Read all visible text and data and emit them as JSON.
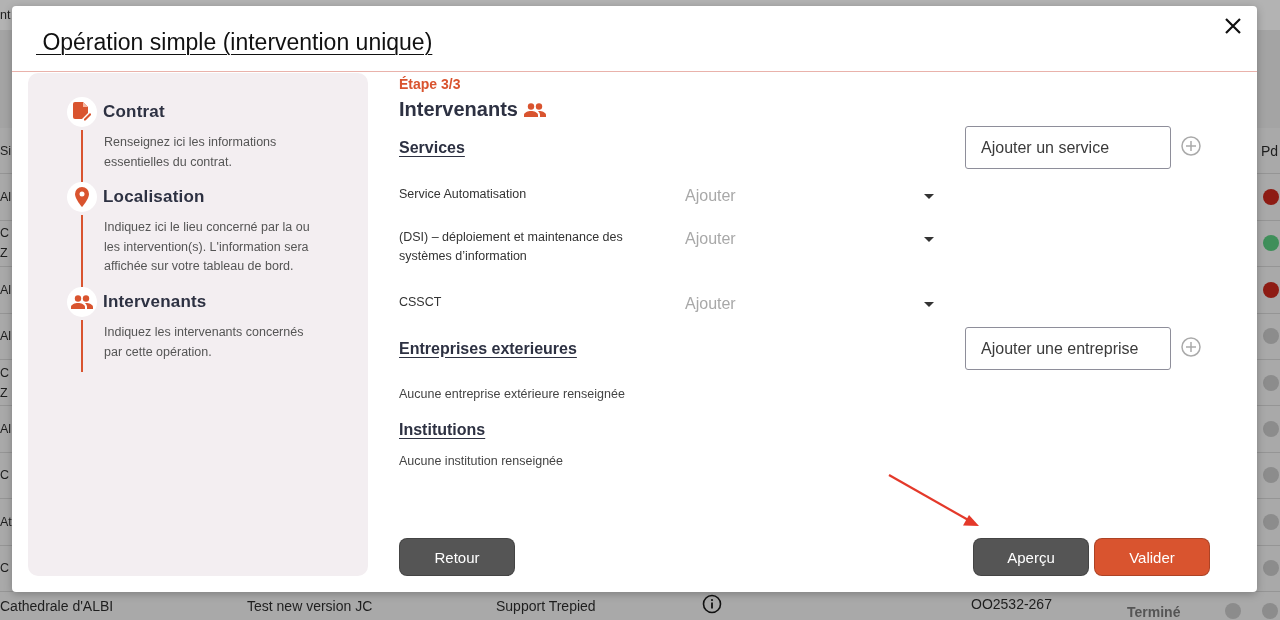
{
  "background_table": {
    "top_text": "nt",
    "header": {
      "column_1": "Si",
      "column_last": "Pd"
    },
    "rows": [
      {
        "column_1": [
          "Al"
        ],
        "color": "#8e1c14"
      },
      {
        "column_1": [
          "C",
          "Z"
        ],
        "color": "#3f8f5a"
      },
      {
        "column_1": [
          "Al"
        ],
        "color": "#8e1c14"
      },
      {
        "column_1": [
          "Al"
        ],
        "color": "#8c8c8c"
      },
      {
        "column_1": [
          "C",
          "Z"
        ],
        "color": "#8c8c8c"
      },
      {
        "column_1": [
          "Al"
        ],
        "color": "#8c8c8c"
      },
      {
        "column_1": [
          "C"
        ],
        "color": "#8c8c8c"
      },
      {
        "column_1": [
          "At"
        ],
        "color": "#8c8c8c"
      },
      {
        "column_1": [
          "C"
        ],
        "color": "#8c8c8c"
      }
    ],
    "last_row": {
      "cells": [
        "Cathedrale d'ALBI",
        "Test new version JC",
        "Support Trepied",
        "OO2532-267",
        "Terminé"
      ],
      "dots": [
        {
          "color": "#8c8c8c"
        },
        {
          "color": "#8c8c8c"
        }
      ]
    }
  },
  "dialog": {
    "title": " Opération simple (intervention unique)",
    "steps": [
      {
        "kind": "contract",
        "title": "Contrat",
        "description": "Renseignez ici les informations essentielles du contrat."
      },
      {
        "kind": "location",
        "title": "Localisation",
        "description": "Indiquez ici le lieu concerné par la ou les intervention(s). L'information sera affichée sur votre tableau de bord."
      },
      {
        "kind": "people",
        "title": "Intervenants",
        "description": "Indiquez les intervenants concernés par cette opération."
      }
    ],
    "step_indicator": "Étape 3/3",
    "heading": "Intervenants",
    "sections": [
      {
        "title": "Services",
        "add_field": {
          "placeholder": "Ajouter un service"
        },
        "rows": [
          {
            "label": "Service Automatisation",
            "select": {
              "placeholder": "Ajouter"
            }
          },
          {
            "label": "(DSI) – déploiement et maintenance des systèmes d’information",
            "select": {
              "placeholder": "Ajouter"
            }
          },
          {
            "label": "CSSCT",
            "select": {
              "placeholder": "Ajouter"
            }
          }
        ]
      },
      {
        "title": "Entreprises exterieures",
        "add_field": {
          "placeholder": "Ajouter une entreprise"
        },
        "empty_text": "Aucune entreprise extérieure renseignée"
      },
      {
        "title": "Institutions",
        "empty_text": "Aucune institution renseignée"
      }
    ],
    "buttons": [
      {
        "label": "Retour",
        "kind": "secondary"
      },
      {
        "label": "Aperçu",
        "kind": "secondary"
      },
      {
        "label": "Valider",
        "kind": "primary"
      }
    ]
  }
}
